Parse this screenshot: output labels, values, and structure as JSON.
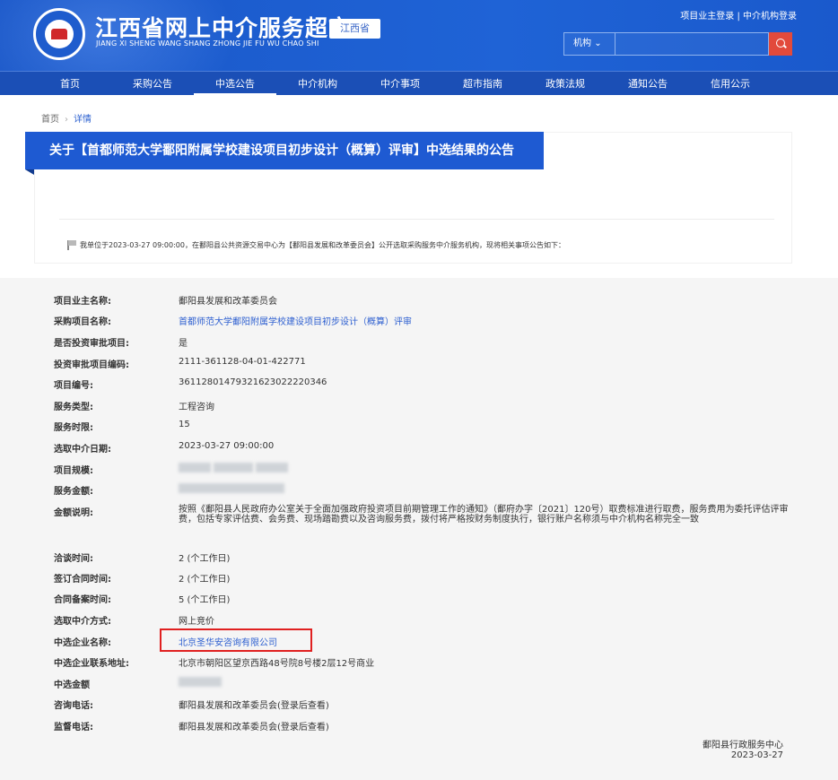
{
  "header": {
    "site_title": "江西省网上中介服务超市",
    "site_subtitle": "JIANG XI SHENG WANG SHANG ZHONG JIE FU WU CHAO SHI",
    "province": "江西省",
    "top_links": "项目业主登录 | 中介机构登录",
    "search_category": "机构",
    "search_placeholder": "",
    "search_icon": "search-icon"
  },
  "nav": {
    "items": [
      "首页",
      "采购公告",
      "中选公告",
      "中介机构",
      "中介事项",
      "超市指南",
      "政策法规",
      "通知公告",
      "信用公示"
    ]
  },
  "breadcrumb": {
    "home": "首页",
    "current": "详情"
  },
  "notice": {
    "title": "关于【首都师范大学鄱阳附属学校建设项目初步设计（概算）评审】中选结果的公告",
    "intro": "我单位于2023-03-27 09:00:00，在鄱阳县公共资源交易中心为【鄱阳县发展和改革委员会】公开选取采购服务中介服务机构，现将相关事项公告如下："
  },
  "details": {
    "owner_label": "项目业主名称:",
    "owner_value": "鄱阳县发展和改革委员会",
    "project_label": "采购项目名称:",
    "project_value": "首都师范大学鄱阳附属学校建设项目初步设计（概算）评审",
    "invest_label": "是否投资审批项目:",
    "invest_value": "是",
    "invest_code_label": "投资审批项目编码:",
    "invest_code_value": "2111-361128-04-01-422771",
    "project_no_label": "项目编号:",
    "project_no_value": "36112801479321623022220346",
    "service_type_label": "服务类型:",
    "service_type_value": "工程咨询",
    "service_term_label": "服务时限:",
    "service_term_value": "15",
    "select_date_label": "选取中介日期:",
    "select_date_value": "2023-03-27 09:00:00",
    "scale_label": "项目规模:",
    "amount_label": "服务金额:",
    "memo_label": "金额说明:",
    "memo_value": "按照《鄱阳县人民政府办公室关于全面加强政府投资项目前期管理工作的通知》（鄱府办字〔2021〕120号）取费标准进行取费，服务费用为委托评估评审费，包括专家评估费、会务费、现场踏勘费以及咨询服务费，拨付将严格按财务制度执行，银行账户名称须与中介机构名称完全一致",
    "negotiate_label": "洽谈时间:",
    "negotiate_value": "2 (个工作日)",
    "sign_label": "签订合同时间:",
    "sign_value": "2 (个工作日)",
    "filing_label": "合同备案时间:",
    "filing_value": "5 (个工作日)",
    "method_label": "选取中介方式:",
    "method_value": "网上竞价",
    "winner_label": "中选企业名称:",
    "winner_value": "北京圣华安咨询有限公司",
    "address_label": "中选企业联系地址:",
    "address_value": "北京市朝阳区望京西路48号院8号楼2层12号商业",
    "win_amount_label": "中选金额",
    "consult_label": "咨询电话:",
    "consult_value": "鄱阳县发展和改革委员会(登录后查看)",
    "supervise_label": "监督电话:",
    "supervise_value": "鄱阳县发展和改革委员会(登录后查看)"
  },
  "footer": {
    "org": "鄱阳县行政服务中心",
    "date": "2023-03-27"
  },
  "colors": {
    "header_blue": "#1f63d6",
    "nav_blue": "#1b4fb6",
    "highlight_red": "#e02020",
    "link_blue": "#2d5fd0"
  }
}
